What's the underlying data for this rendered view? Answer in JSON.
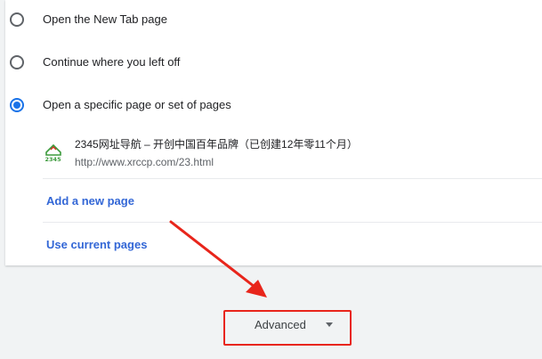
{
  "startup": {
    "options": [
      {
        "label": "Open the New Tab page",
        "checked": false
      },
      {
        "label": "Continue where you left off",
        "checked": false
      },
      {
        "label": "Open a specific page or set of pages",
        "checked": true
      }
    ],
    "pages": [
      {
        "title": "2345网址导航 – 开创中国百年品牌（已创建12年零11个月）",
        "url": "http://www.xrccp.com/23.html",
        "favicon": "2345-favicon-icon"
      }
    ],
    "add_page_label": "Add a new page",
    "use_current_label": "Use current pages"
  },
  "advanced": {
    "label": "Advanced",
    "icon": "caret-down-icon"
  },
  "annotation": {
    "highlight_color": "#e8251b",
    "arrow_icon": "red-arrow-icon"
  },
  "colors": {
    "accent": "#1a73e8",
    "link": "#3367d6",
    "background": "#f1f3f4"
  }
}
